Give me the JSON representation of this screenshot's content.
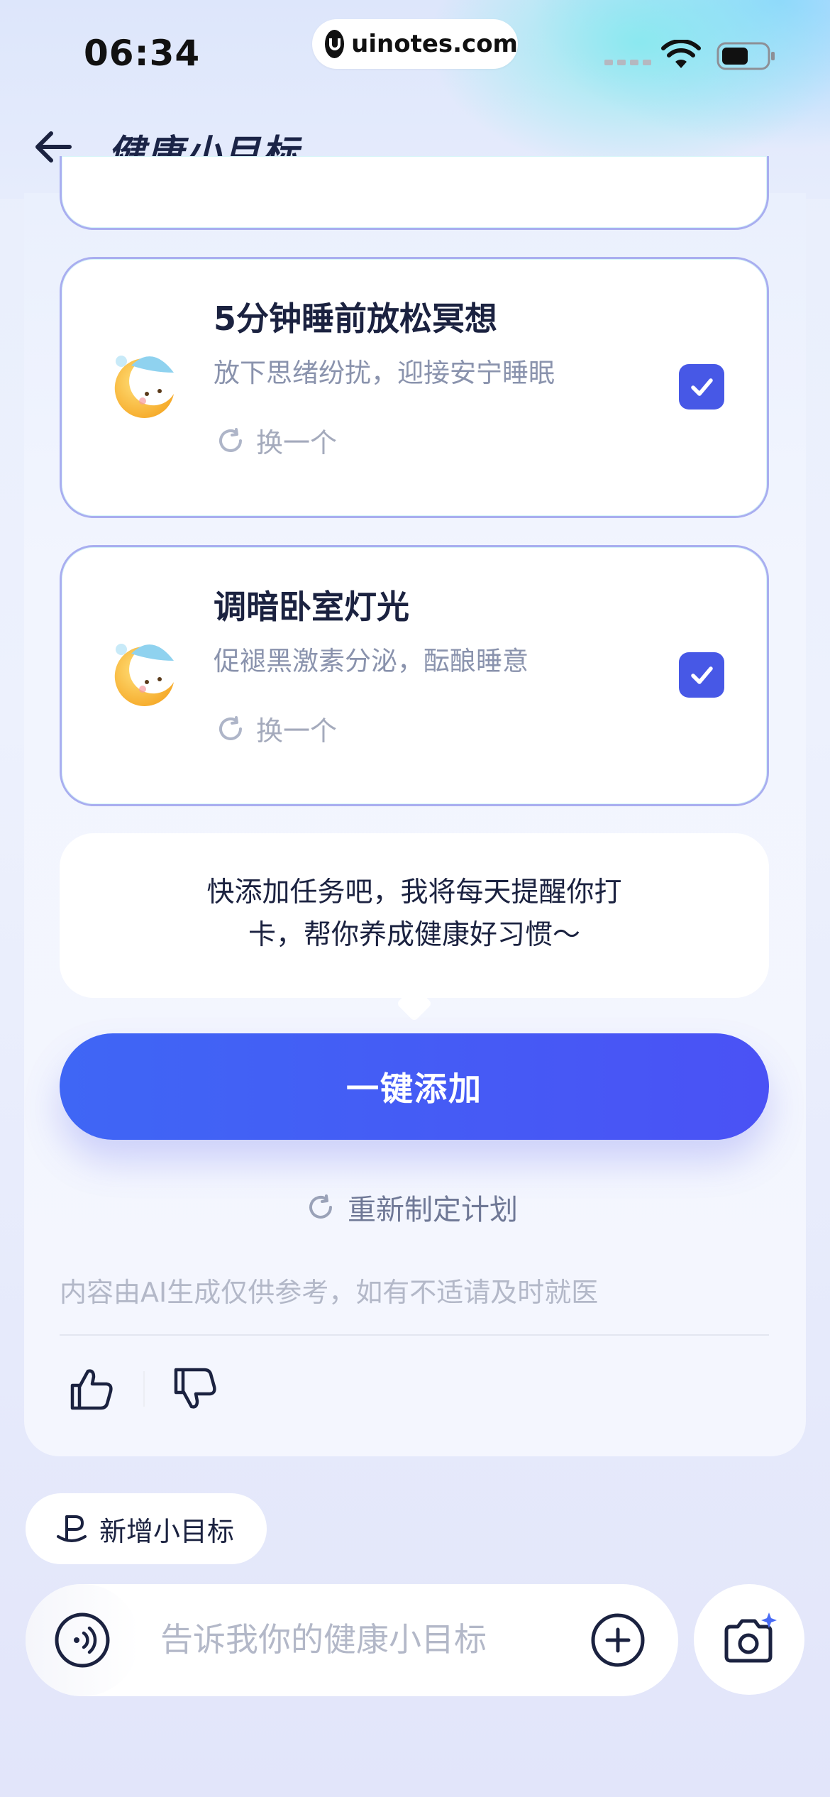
{
  "status_bar": {
    "time": "06:34",
    "url": "uinotes.com"
  },
  "header": {
    "title": "健康小目标"
  },
  "tasks": [
    {
      "title": "5分钟睡前放松冥想",
      "desc": "放下思绪纷扰，迎接安宁睡眠",
      "swap_label": "换一个",
      "checked": true
    },
    {
      "title": "调暗卧室灯光",
      "desc": "促褪黑激素分泌，酝酿睡意",
      "swap_label": "换一个",
      "checked": true
    }
  ],
  "bubble": {
    "line1": "快添加任务吧，我将每天提醒你打",
    "line2": "卡，帮你养成健康好习惯～"
  },
  "actions": {
    "add_all_label": "一键添加",
    "replan_label": "重新制定计划"
  },
  "disclaimer": "内容由AI生成仅供参考，如有不适请及时就医",
  "bottom": {
    "new_goal_label": "新增小目标",
    "input_placeholder": "告诉我你的健康小目标"
  },
  "colors": {
    "accent": "#4758e6",
    "button_gradient_start": "#3f66f5",
    "button_gradient_end": "#4a52f5",
    "title_text": "#1b2240"
  }
}
